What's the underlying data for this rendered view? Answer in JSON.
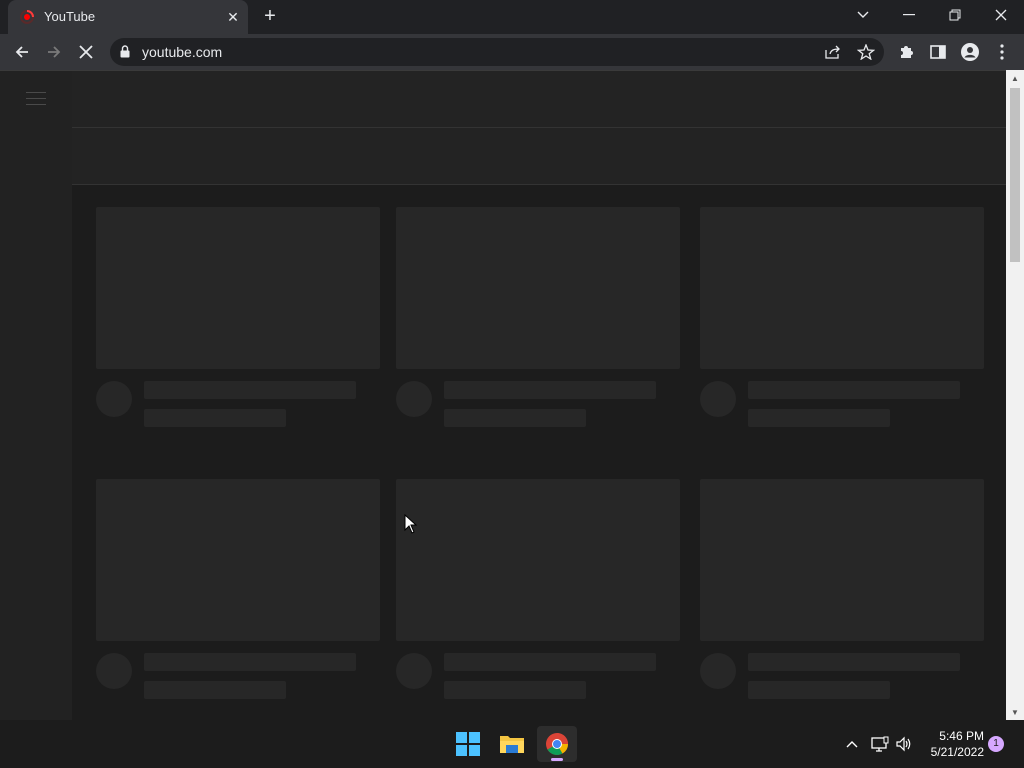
{
  "browser": {
    "tab": {
      "title": "YouTube",
      "favicon": "youtube-loading-icon"
    },
    "new_tab_symbol": "+",
    "address_bar": {
      "url": "youtube.com"
    },
    "accent_color": "#35363a"
  },
  "page": {
    "state": "loading skeleton",
    "skeleton_rows": 2,
    "skeleton_columns": 3
  },
  "taskbar": {
    "clock_time": "5:46 PM",
    "clock_date": "5/21/2022",
    "notification_count": "1",
    "pinned": [
      "start-icon",
      "file-explorer-icon",
      "chrome-icon"
    ]
  }
}
